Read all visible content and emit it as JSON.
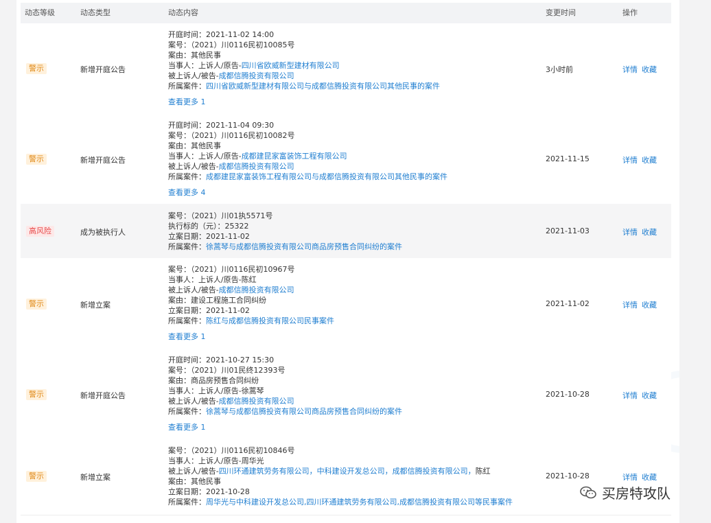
{
  "columns": {
    "level": "动态等级",
    "type": "动态类型",
    "content": "动态内容",
    "time": "变更时间",
    "ops": "操作"
  },
  "ops": {
    "detail": "详情",
    "collect": "收藏"
  },
  "rows": [
    {
      "level": "警示",
      "level_kind": "warn",
      "type": "新增开庭公告",
      "time": "3小时前",
      "lines": [
        {
          "label": "开庭时间：",
          "value": "2021-11-02 14:00"
        },
        {
          "label": "案号：",
          "value": "（2021）川0116民初10085号"
        },
        {
          "label": "案由：",
          "value": "其他民事"
        },
        {
          "label": "当事人：上诉人/原告-",
          "link": "四川省欧威新型建材有限公司"
        },
        {
          "label": "被上诉人/被告-",
          "link": "成都信腾投资有限公司"
        },
        {
          "label": "所属案件：",
          "link": "四川省欧威新型建材有限公司与成都信腾投资有限公司其他民事的案件"
        }
      ],
      "more": "查看更多 1"
    },
    {
      "level": "警示",
      "level_kind": "warn",
      "type": "新增开庭公告",
      "time": "2021-11-15",
      "lines": [
        {
          "label": "开庭时间：",
          "value": "2021-11-04 09:30"
        },
        {
          "label": "案号：",
          "value": "（2021）川0116民初10082号"
        },
        {
          "label": "案由：",
          "value": "其他民事"
        },
        {
          "label": "当事人：上诉人/原告-",
          "link": "成都建昆家富装饰工程有限公司"
        },
        {
          "label": "被上诉人/被告-",
          "link": "成都信腾投资有限公司"
        },
        {
          "label": "所属案件：",
          "link": "成都建昆家富装饰工程有限公司与成都信腾投资有限公司其他民事的案件"
        }
      ],
      "more": "查看更多 4"
    },
    {
      "level": "高风险",
      "level_kind": "high",
      "type": "成为被执行人",
      "time": "2021-11-03",
      "lines": [
        {
          "label": "案号：",
          "value": "（2021）川01执5571号"
        },
        {
          "label": "执行标的（元）：",
          "value": "25322"
        },
        {
          "label": "立案日期：",
          "value": "2021-11-02"
        },
        {
          "label": "所属案件：",
          "link": "徐蒿琴与成都信腾投资有限公司商品房预售合同纠纷的案件"
        }
      ],
      "more": ""
    },
    {
      "level": "警示",
      "level_kind": "warn",
      "type": "新增立案",
      "time": "2021-11-02",
      "lines": [
        {
          "label": "案号：",
          "value": "（2021）川0116民初10967号"
        },
        {
          "label": "当事人：上诉人/原告-",
          "value": "陈红"
        },
        {
          "label": "被上诉人/被告-",
          "link": "成都信腾投资有限公司"
        },
        {
          "label": "案由：",
          "value": "建设工程施工合同纠纷"
        },
        {
          "label": "立案日期：",
          "value": "2021-11-02"
        },
        {
          "label": "所属案件：",
          "link": "陈红与成都信腾投资有限公司民事案件"
        }
      ],
      "more": "查看更多 1"
    },
    {
      "level": "警示",
      "level_kind": "warn",
      "type": "新增开庭公告",
      "time": "2021-10-28",
      "lines": [
        {
          "label": "开庭时间：",
          "value": "2021-10-27 15:30"
        },
        {
          "label": "案号：",
          "value": "（2021）川01民终12393号"
        },
        {
          "label": "案由：",
          "value": "商品房预售合同纠纷"
        },
        {
          "label": "当事人：上诉人/原告-",
          "value": "徐蒿琴"
        },
        {
          "label": "被上诉人/被告-",
          "link": "成都信腾投资有限公司"
        },
        {
          "label": "所属案件：",
          "link": "徐蒿琴与成都信腾投资有限公司商品房预售合同纠纷的案件"
        }
      ],
      "more": "查看更多 1"
    },
    {
      "level": "警示",
      "level_kind": "warn",
      "type": "新增立案",
      "time": "2021-10-28",
      "lines": [
        {
          "label": "案号：",
          "value": "（2021）川0116民初10846号"
        },
        {
          "label": "当事人：上诉人/原告-",
          "value": "周华光"
        },
        {
          "label": "被上诉人/被告-",
          "link": "四川环通建筑劳务有限公司，中科建设开发总公司，成都信腾投资有限公司，",
          "tail": "陈红"
        },
        {
          "label": "案由：",
          "value": "其他民事"
        },
        {
          "label": "立案日期：",
          "value": "2021-10-28"
        },
        {
          "label": "所属案件：",
          "link": "周华光与中科建设开发总公司,四川环通建筑劳务有限公司,成都信腾投资有限公司等民事案件"
        }
      ],
      "more": ""
    }
  ],
  "wechat": {
    "label": "买房特攻队"
  }
}
